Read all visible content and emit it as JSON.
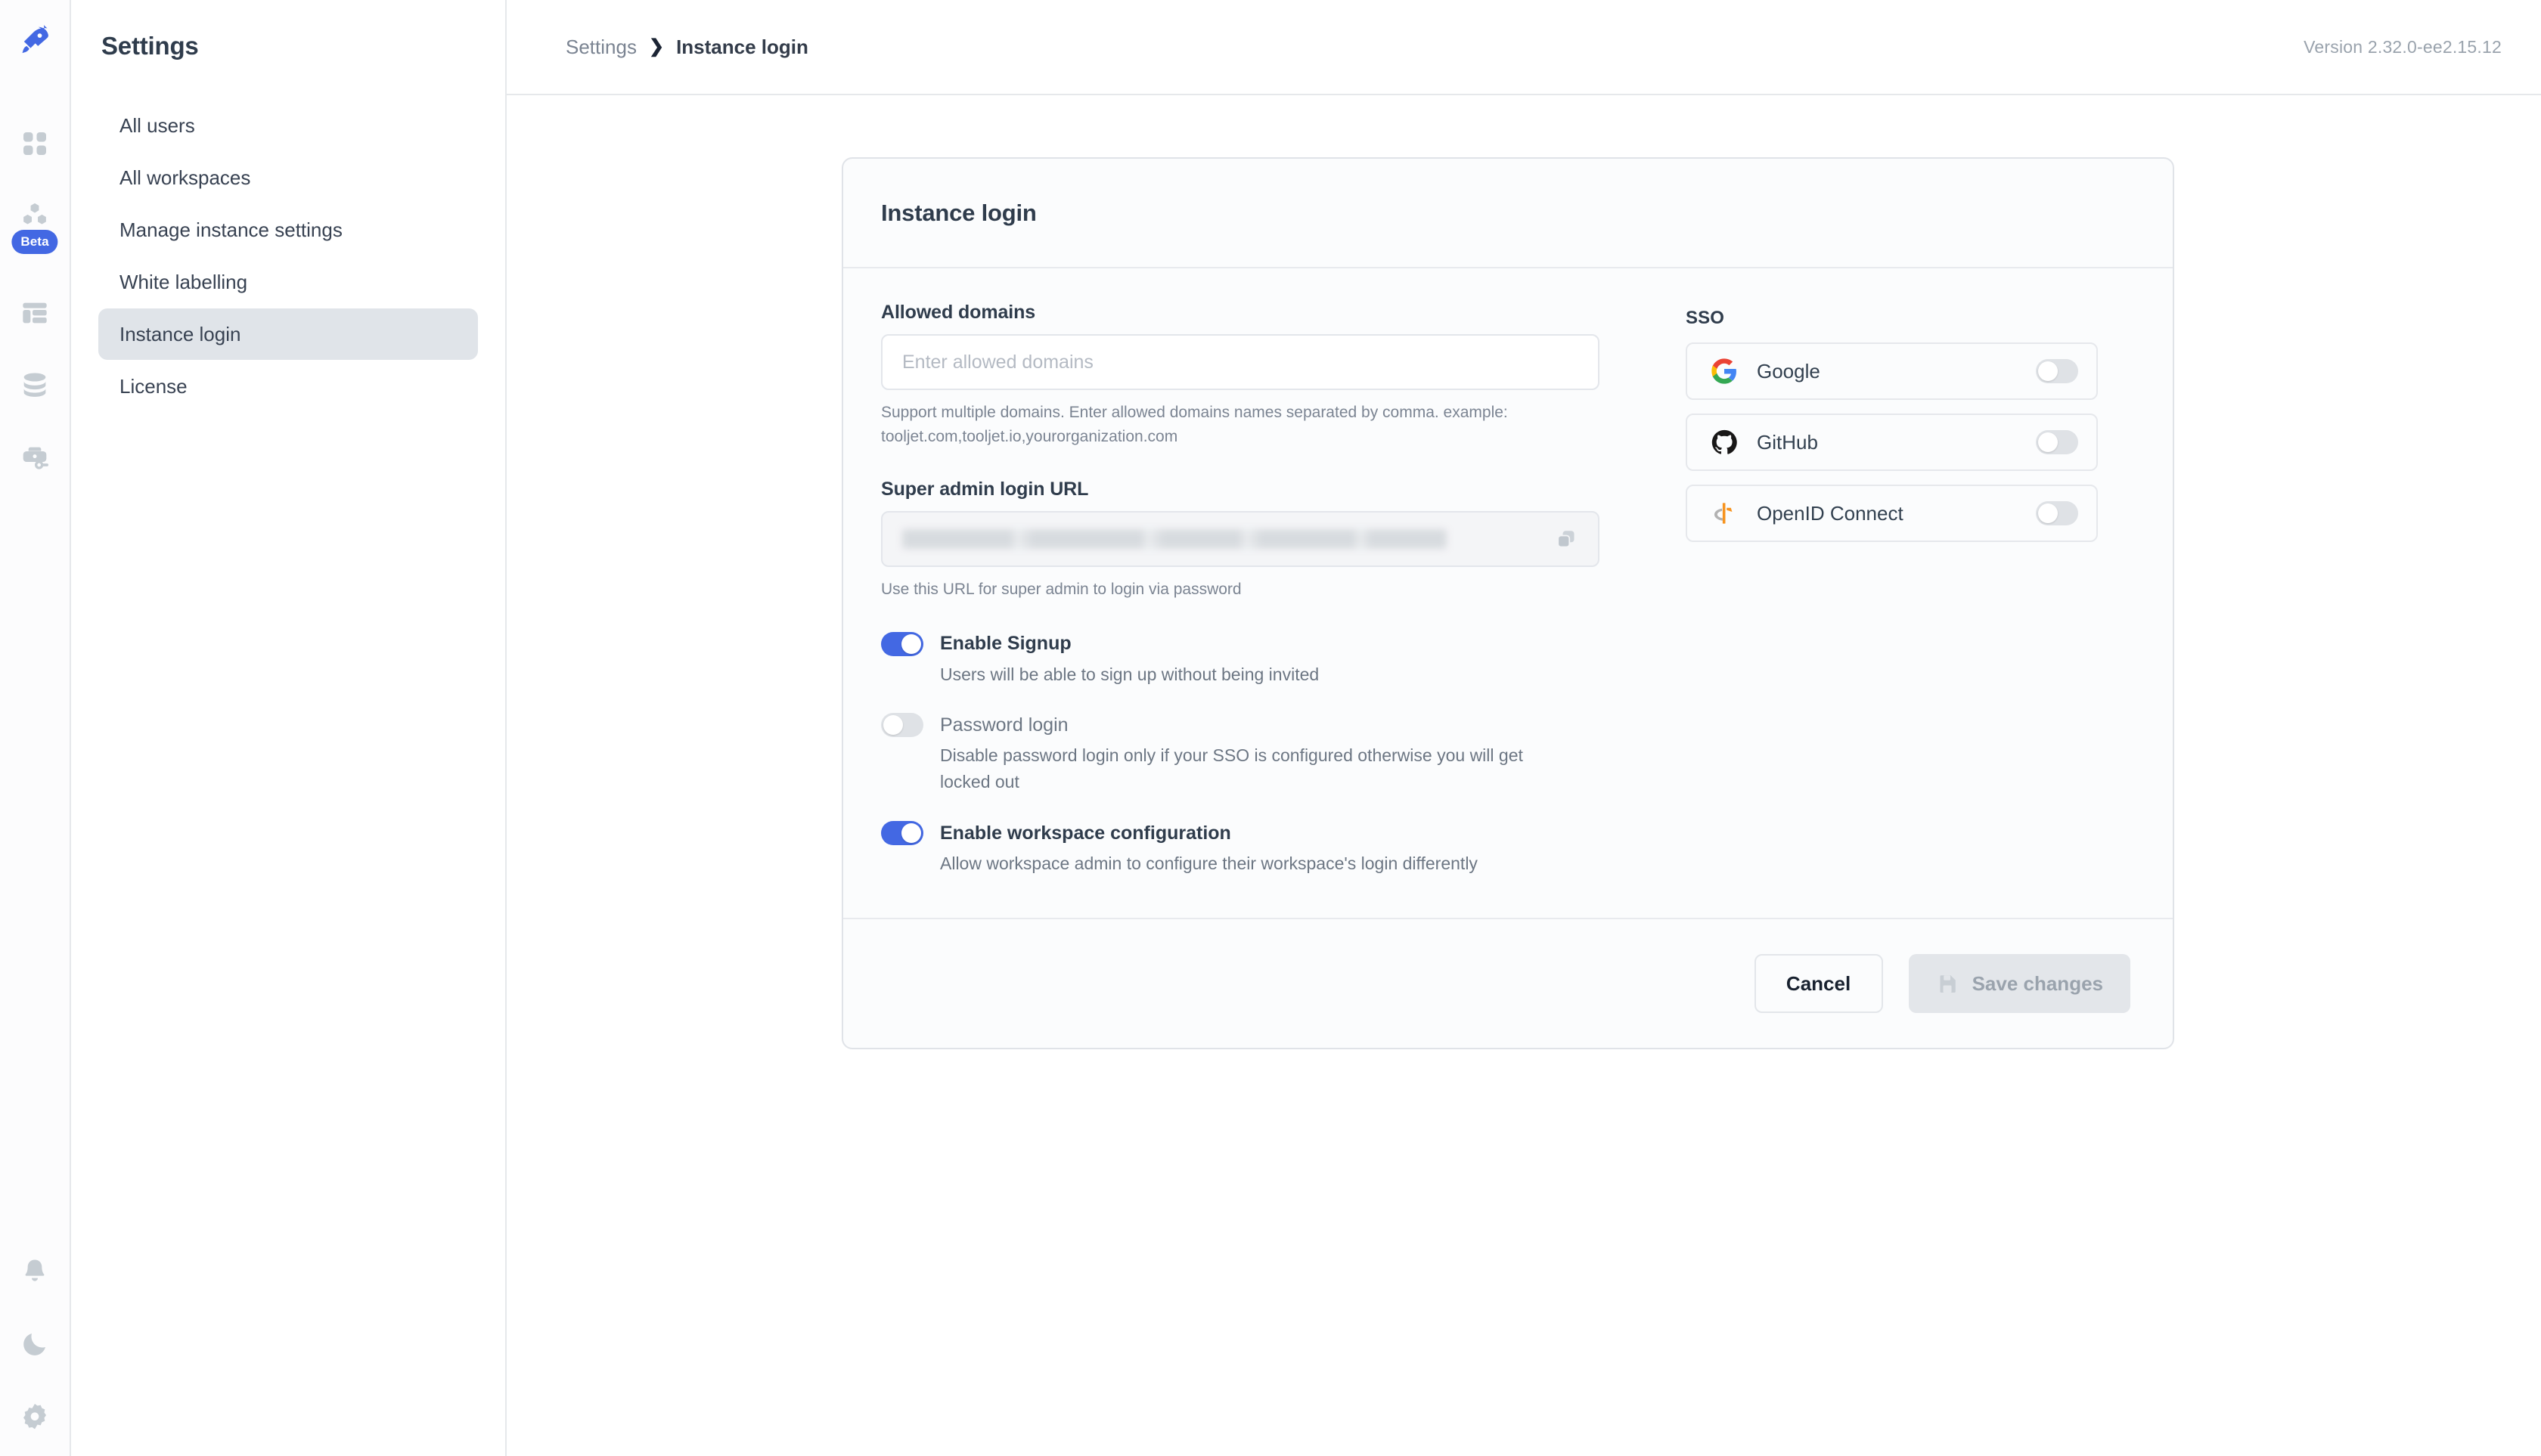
{
  "rail": {
    "items": [
      {
        "name": "rocket-logo-icon",
        "label": "ToolJet"
      },
      {
        "name": "apps-grid-icon",
        "label": "Apps"
      },
      {
        "name": "workflows-icon",
        "label": "Workflows",
        "badge": "Beta"
      },
      {
        "name": "database-table-icon",
        "label": "Tables"
      },
      {
        "name": "data-sources-icon",
        "label": "Data sources"
      },
      {
        "name": "marketplace-key-icon",
        "label": "Marketplace"
      }
    ],
    "bottom_items": [
      {
        "name": "notifications-bell-icon",
        "label": "Notifications"
      },
      {
        "name": "dark-mode-moon-icon",
        "label": "Dark mode"
      },
      {
        "name": "settings-gear-icon",
        "label": "Settings"
      }
    ]
  },
  "sidebar": {
    "title": "Settings",
    "items": [
      {
        "label": "All users",
        "active": false
      },
      {
        "label": "All workspaces",
        "active": false
      },
      {
        "label": "Manage instance settings",
        "active": false
      },
      {
        "label": "White labelling",
        "active": false
      },
      {
        "label": "Instance login",
        "active": true
      },
      {
        "label": "License",
        "active": false
      }
    ]
  },
  "topbar": {
    "breadcrumb_root": "Settings",
    "breadcrumb_separator": "❯",
    "breadcrumb_current": "Instance login",
    "version": "Version 2.32.0-ee2.15.12"
  },
  "card": {
    "title": "Instance login",
    "allowed_domains": {
      "label": "Allowed domains",
      "value": "",
      "placeholder": "Enter allowed domains",
      "help": "Support multiple domains. Enter allowed domains names separated by comma. example: tooljet.com,tooljet.io,yourorganization.com"
    },
    "super_admin_url": {
      "label": "Super admin login URL",
      "value": "",
      "help": "Use this URL for super admin to login via password",
      "copy_icon": "copy-icon"
    },
    "toggles": [
      {
        "label": "Enable Signup",
        "description": "Users will be able to sign up without being invited",
        "on": true
      },
      {
        "label": "Password login",
        "description": "Disable password login only if your SSO is configured otherwise you will get locked out",
        "on": false
      },
      {
        "label": "Enable workspace configuration",
        "description": "Allow workspace admin to configure their workspace's login differently",
        "on": true
      }
    ],
    "sso": {
      "title": "SSO",
      "providers": [
        {
          "label": "Google",
          "icon": "google-icon",
          "on": false
        },
        {
          "label": "GitHub",
          "icon": "github-icon",
          "on": false
        },
        {
          "label": "OpenID Connect",
          "icon": "openid-connect-icon",
          "on": false
        }
      ]
    },
    "footer": {
      "cancel_label": "Cancel",
      "save_label": "Save changes",
      "save_icon": "floppy-save-icon",
      "save_disabled": true
    }
  },
  "colors": {
    "accent": "#4368e3",
    "toggle_off": "#dfe2e6",
    "card_bg": "#fbfcfd",
    "border": "#e0e3e8",
    "text_dark": "#2f3c4c",
    "text_muted": "#6c7683"
  }
}
